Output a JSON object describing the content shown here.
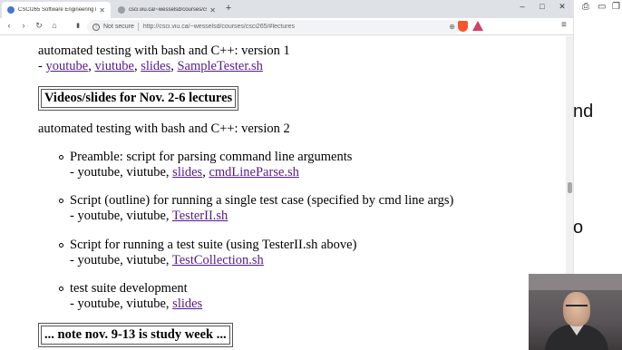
{
  "browser": {
    "tabs": [
      {
        "title": "CSCI265 Software Engineering Fall",
        "active": true
      },
      {
        "title": "csci.viu.ca/~wesselsd/courses/csci",
        "active": false
      }
    ],
    "new_tab_symbol": "+",
    "nav": {
      "back": "‹",
      "forward": "›",
      "reload": "↻",
      "home": "⌂",
      "bookmark": "▮"
    },
    "address": {
      "security_label": "Not secure",
      "url": "http://csci.viu.ca/~wesselsd/courses/csci265/#lectures"
    },
    "window_controls": {
      "minimize": "–",
      "maximize": "□",
      "close": "✕"
    },
    "menu_symbol": "≡"
  },
  "page": {
    "v1_intro": "automated testing with bash and C++: version 1",
    "v1_links_prefix": "- ",
    "v1_links": [
      "youtube",
      "viutube",
      "slides",
      "SampleTester.sh"
    ],
    "section_heading": "Videos/slides for Nov. 2-6 lectures",
    "v2_intro": "automated testing with bash and C++: version 2",
    "items": [
      {
        "title": "Preamble: script for parsing command line arguments",
        "plain": "- youtube, viutube, ",
        "links": [
          "slides",
          "cmdLineParse.sh"
        ]
      },
      {
        "title": "Script (outline) for running a single test case (specified by cmd line args)",
        "plain": "- youtube, viutube, ",
        "links": [
          "TesterII.sh"
        ]
      },
      {
        "title": "Script for running a test suite (using TesterII.sh above)",
        "plain": "- youtube, viutube, ",
        "links": [
          "TestCollection.sh"
        ]
      },
      {
        "title": "test suite development",
        "plain": "- youtube, viutube, ",
        "links": [
          "slides"
        ]
      }
    ],
    "note_heading": "... note nov. 9-13 is study week ..."
  },
  "background_window": {
    "fragments": [
      "nd",
      "o"
    ],
    "icons": [
      "printer-icon",
      "folder-icon",
      "copy-icon"
    ]
  },
  "colors": {
    "link": "#551a8b",
    "tabbar": "#dee1e6",
    "omnibox": "#f1f3f4"
  }
}
